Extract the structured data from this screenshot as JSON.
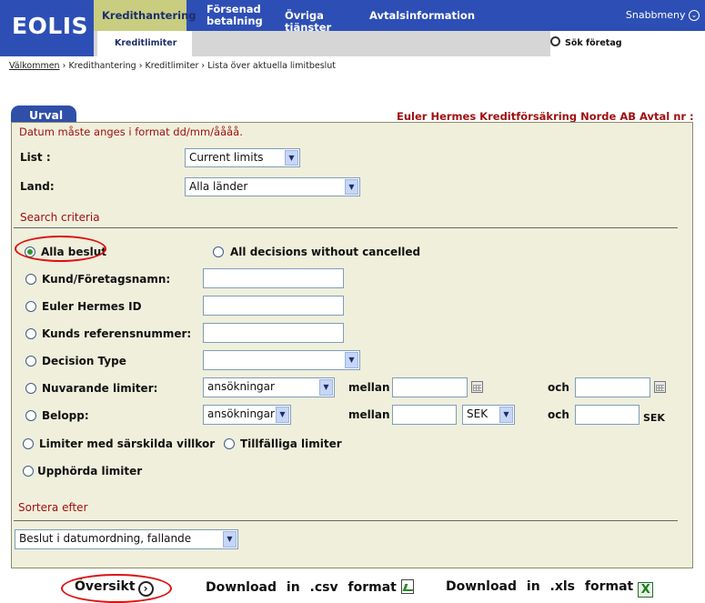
{
  "header": {
    "logo_text": "EOLIS",
    "nav": [
      {
        "label": "Kredithantering"
      },
      {
        "label": "Försenad betalning"
      },
      {
        "label": "Övriga tjänster"
      },
      {
        "label": "Avtalsinformation"
      }
    ],
    "quick_menu": "Snabbmeny",
    "sub_tab": "Kreditlimiter",
    "search_company": "Sök företag"
  },
  "breadcrumb": {
    "home": "Välkommen",
    "sep": "›",
    "items": [
      "Kredithantering",
      "Kreditlimiter",
      "Lista över aktuella limitbeslut"
    ]
  },
  "panel": {
    "tab_label": "Urval",
    "company": "Euler Hermes Kreditförsäkring Norde AB Avtal nr :",
    "date_note": "Datum måste anges i format dd/mm/åååå.",
    "list_label": "List :",
    "list_value": "Current limits",
    "land_label": "Land:",
    "land_value": "Alla länder",
    "search_criteria": "Search criteria",
    "opt_alla_beslut": "Alla beslut",
    "opt_all_decisions": "All decisions without cancelled",
    "opt_kund": "Kund/Företagsnamn:",
    "opt_eh_id": "Euler Hermes ID",
    "opt_ref": "Kunds referensnummer:",
    "opt_decision_type": "Decision Type",
    "opt_nuvarande": "Nuvarande limiter:",
    "nuvarande_select": "ansökningar",
    "opt_belopp": "Belopp:",
    "belopp_select": "ansökningar",
    "mellan": "mellan",
    "och": "och",
    "currency": "SEK",
    "currency_unit": "SEK",
    "opt_sarskilda": "Limiter med särskilda villkor",
    "opt_tillfalliga": "Tillfälliga limiter",
    "opt_upphorda": "Upphörda limiter",
    "sort_label": "Sortera efter",
    "sort_value": "Beslut i datumordning, fallande"
  },
  "footer": {
    "oversikt": "Översikt",
    "download_csv": "Download in .csv format",
    "download_xls": "Download in .xls format"
  },
  "colors": {
    "brand_blue": "#2d4fb5",
    "active_tab": "#c8cd80",
    "panel_bg": "#efefdc",
    "accent_red": "#a01010",
    "annotation_red": "#dd1111"
  }
}
